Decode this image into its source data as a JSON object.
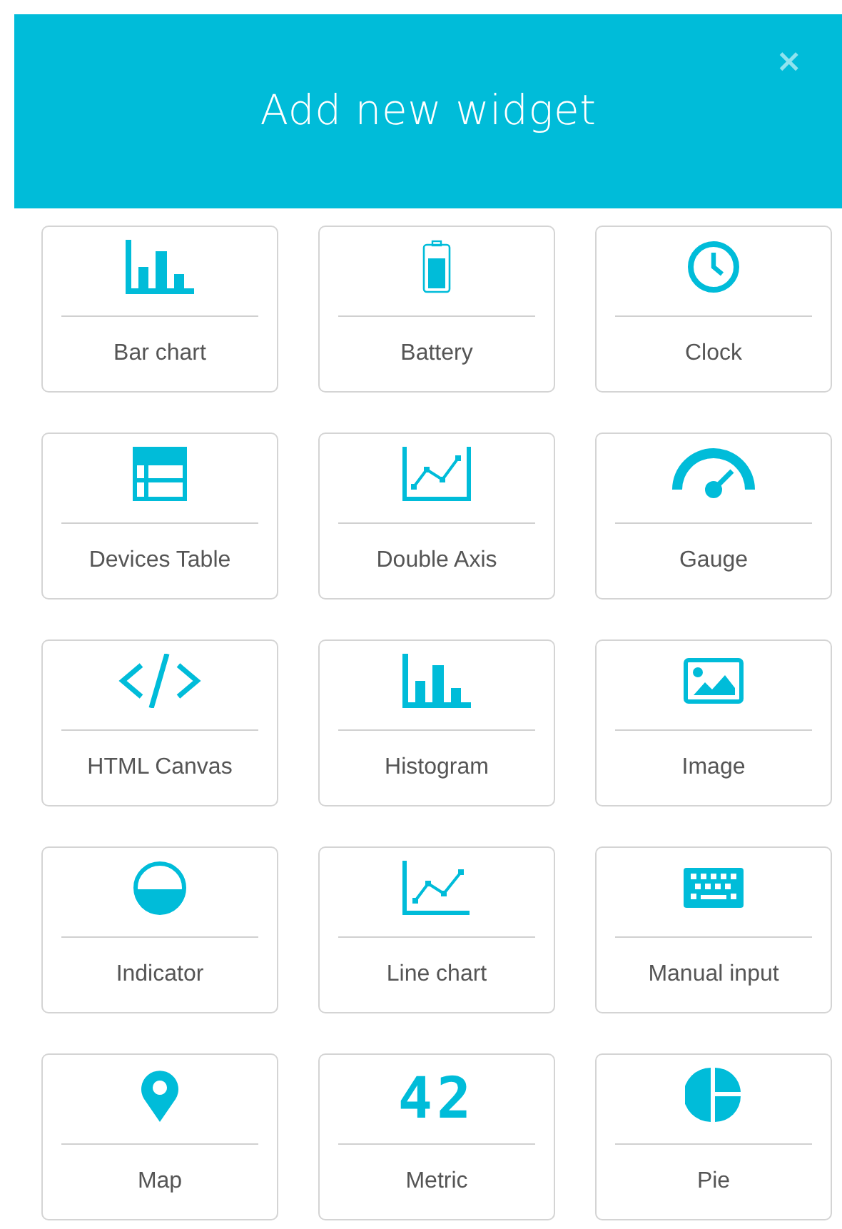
{
  "dialog": {
    "title": "Add new widget",
    "close": "×"
  },
  "widget_rows": [
    [
      {
        "kind": "bar",
        "label": "Bar chart"
      },
      {
        "kind": "battery",
        "label": "Battery"
      },
      {
        "kind": "clock",
        "label": "Clock"
      }
    ],
    [
      {
        "kind": "table",
        "label": "Devices Table"
      },
      {
        "kind": "double-axis",
        "label": "Double Axis"
      },
      {
        "kind": "gauge",
        "label": "Gauge"
      }
    ],
    [
      {
        "kind": "code",
        "label": "HTML Canvas"
      },
      {
        "kind": "histogram",
        "label": "Histogram"
      },
      {
        "kind": "image",
        "label": "Image"
      }
    ],
    [
      {
        "kind": "indicator",
        "label": "Indicator"
      },
      {
        "kind": "line",
        "label": "Line chart"
      },
      {
        "kind": "keyboard",
        "label": "Manual input"
      }
    ],
    [
      {
        "kind": "map",
        "label": "Map"
      },
      {
        "kind": "metric",
        "glyph": "42",
        "label": "Metric"
      },
      {
        "kind": "pie",
        "label": "Pie"
      }
    ]
  ]
}
